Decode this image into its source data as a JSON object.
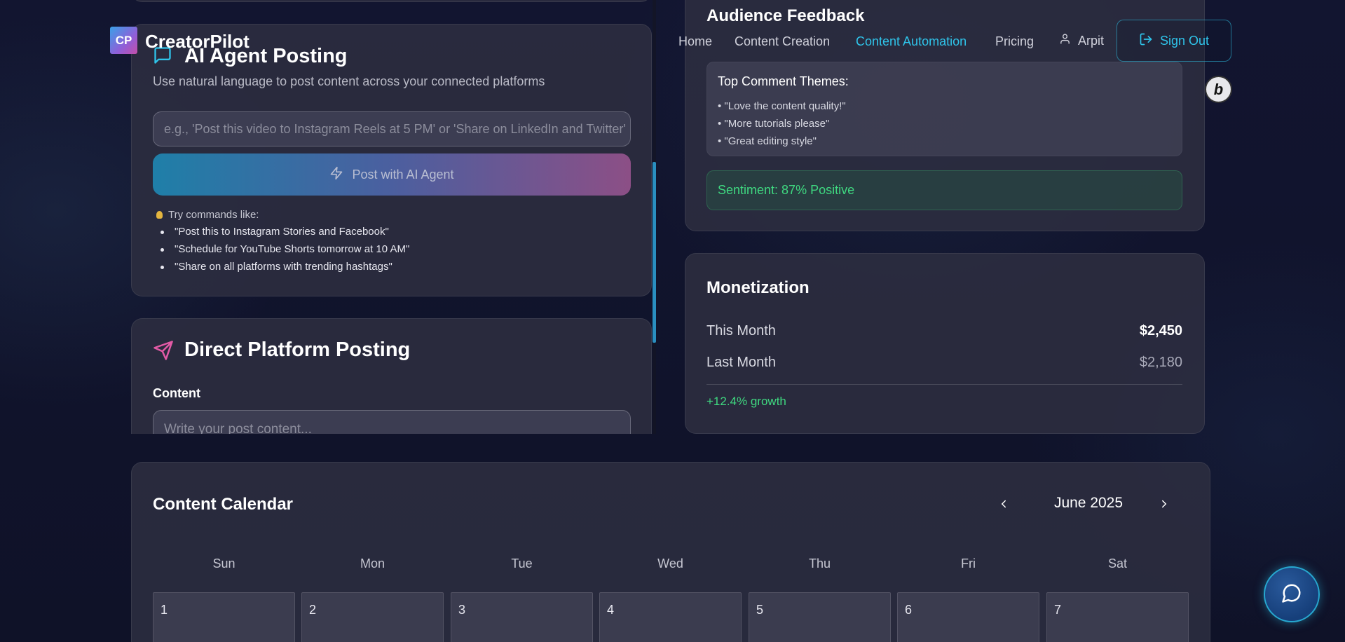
{
  "header": {
    "logo_text": "CP",
    "brand": "CreatorPilot",
    "nav": [
      "Home",
      "Content Creation",
      "Content Automation",
      "Pricing"
    ],
    "active_nav": "Content Automation",
    "user_name": "Arpit",
    "sign_out": "Sign Out"
  },
  "ai_agent": {
    "title": "AI Agent Posting",
    "subtitle": "Use natural language to post content across your connected platforms",
    "input_placeholder": "e.g., 'Post this video to Instagram Reels at 5 PM' or 'Share on LinkedIn and Twitter'",
    "button": "Post with AI Agent",
    "tips_heading": "Try commands like:",
    "tips": [
      "\"Post this to Instagram Stories and Facebook\"",
      "\"Schedule for YouTube Shorts tomorrow at 10 AM\"",
      "\"Share on all platforms with trending hashtags\""
    ]
  },
  "direct_posting": {
    "title": "Direct Platform Posting",
    "content_label": "Content",
    "content_placeholder": "Write your post content..."
  },
  "audience_feedback": {
    "title": "Audience Feedback",
    "themes_heading": "Top Comment Themes:",
    "themes": [
      "\"Love the content quality!\"",
      "\"More tutorials please\"",
      "\"Great editing style\""
    ],
    "sentiment": "Sentiment: 87% Positive"
  },
  "monetization": {
    "title": "Monetization",
    "this_month_label": "This Month",
    "this_month_value": "$2,450",
    "last_month_label": "Last Month",
    "last_month_value": "$2,180",
    "growth": "+12.4% growth"
  },
  "calendar": {
    "title": "Content Calendar",
    "month": "June 2025",
    "weekdays": [
      "Sun",
      "Mon",
      "Tue",
      "Wed",
      "Thu",
      "Fri",
      "Sat"
    ],
    "days": [
      "1",
      "2",
      "3",
      "4",
      "5",
      "6",
      "7"
    ]
  },
  "colors": {
    "accent": "#2fc4ea",
    "positive": "#3fd880",
    "background": "#101226",
    "card": "#2c2d40"
  },
  "icons": {
    "ai_agent": "message-square-icon",
    "direct_posting": "send-icon",
    "user": "user-icon",
    "sign_out": "log-out-icon",
    "ai_button": "zap-icon",
    "tip": "lightbulb-icon",
    "chat": "message-circle-icon"
  }
}
